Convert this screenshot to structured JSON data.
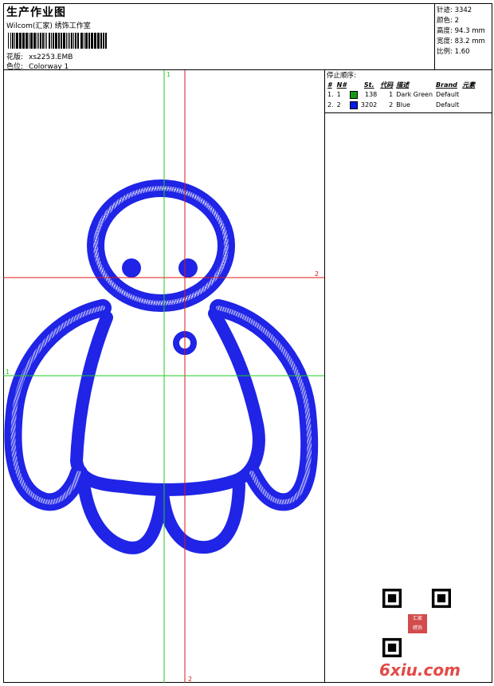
{
  "header": {
    "title": "生产作业图",
    "subtitle": "Wilcom(汇家) 绣饰工作室",
    "design_label": "花版:",
    "design_value": "xs2253.EMB",
    "colorway_label": "色位:",
    "colorway_value": "Colorway 1"
  },
  "stats": [
    {
      "label": "针迹:",
      "value": "3342"
    },
    {
      "label": "颜色:",
      "value": "2"
    },
    {
      "label": "高度:",
      "value": "94.3 mm"
    },
    {
      "label": "宽度:",
      "value": "83.2 mm"
    },
    {
      "label": "比例:",
      "value": "1.60"
    }
  ],
  "stop_sequence": {
    "title": "停止顺序:",
    "columns": [
      "#",
      "N#",
      "St.",
      "代码",
      "描述",
      "Brand",
      "元素"
    ],
    "rows": [
      {
        "index": "1.",
        "n": "1",
        "color": "#119a11",
        "stitches": "138",
        "code": "1",
        "desc": "Dark Green",
        "brand": "Default"
      },
      {
        "index": "2.",
        "n": "2",
        "color": "#0a18e8",
        "stitches": "3202",
        "code": "2",
        "desc": "Blue",
        "brand": "Default"
      }
    ]
  },
  "guides": {
    "green_v_label": "1",
    "green_h_label": "1",
    "red_h_label": "2",
    "red_v_label": "2"
  },
  "colors": {
    "stitch": "#1f24e6",
    "guide_green": "#22cc22",
    "guide_red": "#e01818"
  },
  "watermark": {
    "text": "6xiu.com",
    "seal_text": [
      "汇家",
      "绣饰"
    ]
  }
}
